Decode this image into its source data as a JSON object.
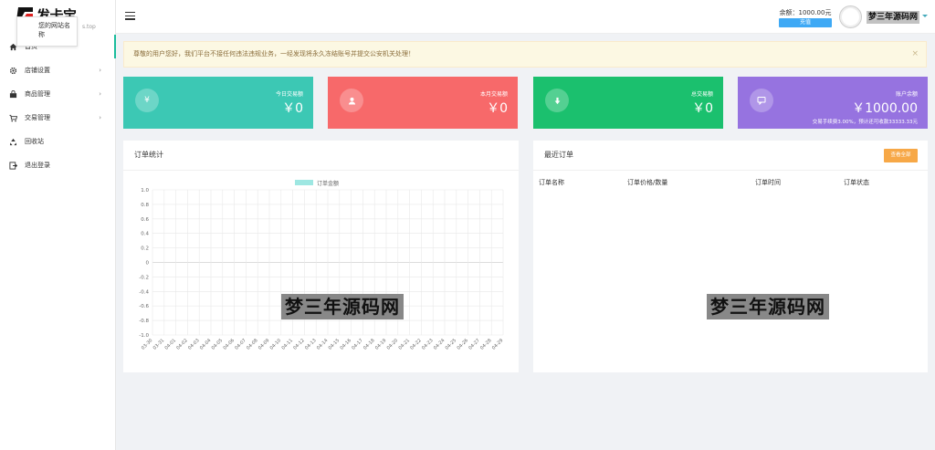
{
  "brand": {
    "name": "发卡宝",
    "sub": "s.top"
  },
  "tooltip": {
    "text": "您的网站名称"
  },
  "sidebar": {
    "items": [
      {
        "label": "首页",
        "icon": "home-icon",
        "arrow": ""
      },
      {
        "label": "店铺设置",
        "icon": "gear-icon",
        "arrow": "›"
      },
      {
        "label": "商品管理",
        "icon": "bag-icon",
        "arrow": "›"
      },
      {
        "label": "交易管理",
        "icon": "cart-icon",
        "arrow": "›"
      },
      {
        "label": "回收站",
        "icon": "recycle-icon",
        "arrow": ""
      },
      {
        "label": "退出登录",
        "icon": "logout-icon",
        "arrow": ""
      }
    ]
  },
  "topbar": {
    "balance": "余额：1000.00元",
    "recharge": "充值",
    "username": "梦三年源码网"
  },
  "alert": {
    "text": "尊敬的用户您好，我们平台不接任何违法违规业务，一经发现将永久冻结账号并提交公安机关处理！",
    "close": "×"
  },
  "cards": [
    {
      "label": "今日交易额",
      "value": "￥0",
      "icon": "yen-icon",
      "glyph": "¥",
      "color": "#3cc8b4",
      "note": ""
    },
    {
      "label": "本月交易额",
      "value": "￥0",
      "icon": "user-icon",
      "glyph": "",
      "color": "#f7696a",
      "note": ""
    },
    {
      "label": "总交易额",
      "value": "￥0",
      "icon": "download-icon",
      "glyph": "",
      "color": "#1bc06e",
      "note": ""
    },
    {
      "label": "账户余额",
      "value": "￥1000.00",
      "icon": "chat-icon",
      "glyph": "",
      "color": "#9673e0",
      "note": "交易手续费3.00%，预计还可收款33333.33元"
    }
  ],
  "order_stats": {
    "title": "订单统计"
  },
  "recent_orders": {
    "title": "最近订单",
    "view_all": "查看全部",
    "columns": [
      "订单名称",
      "订单价格/数量",
      "订单时间",
      "订单状态"
    ],
    "rows": []
  },
  "watermark": "梦三年源码网",
  "colors": {
    "accent": "#1abc9c",
    "legend": "#9ee7e2",
    "grid": "#e8e8e8"
  },
  "chart_data": {
    "type": "line",
    "legend": [
      "订单金额"
    ],
    "legend_position": "top",
    "categories": [
      "03-30",
      "03-31",
      "04-01",
      "04-02",
      "04-03",
      "04-04",
      "04-05",
      "04-06",
      "04-07",
      "04-08",
      "04-09",
      "04-10",
      "04-11",
      "04-12",
      "04-13",
      "04-14",
      "04-15",
      "04-16",
      "04-17",
      "04-18",
      "04-19",
      "04-20",
      "04-21",
      "04-22",
      "04-23",
      "04-24",
      "04-25",
      "04-26",
      "04-27",
      "04-28",
      "04-29"
    ],
    "series": [
      {
        "name": "订单金额",
        "values": []
      }
    ],
    "yticks": [
      "1.0",
      "0.8",
      "0.6",
      "0.4",
      "0.2",
      "0",
      "-0.2",
      "-0.4",
      "-0.6",
      "-0.8",
      "-1.0"
    ],
    "ylim": [
      -1,
      1
    ],
    "grid": true
  }
}
